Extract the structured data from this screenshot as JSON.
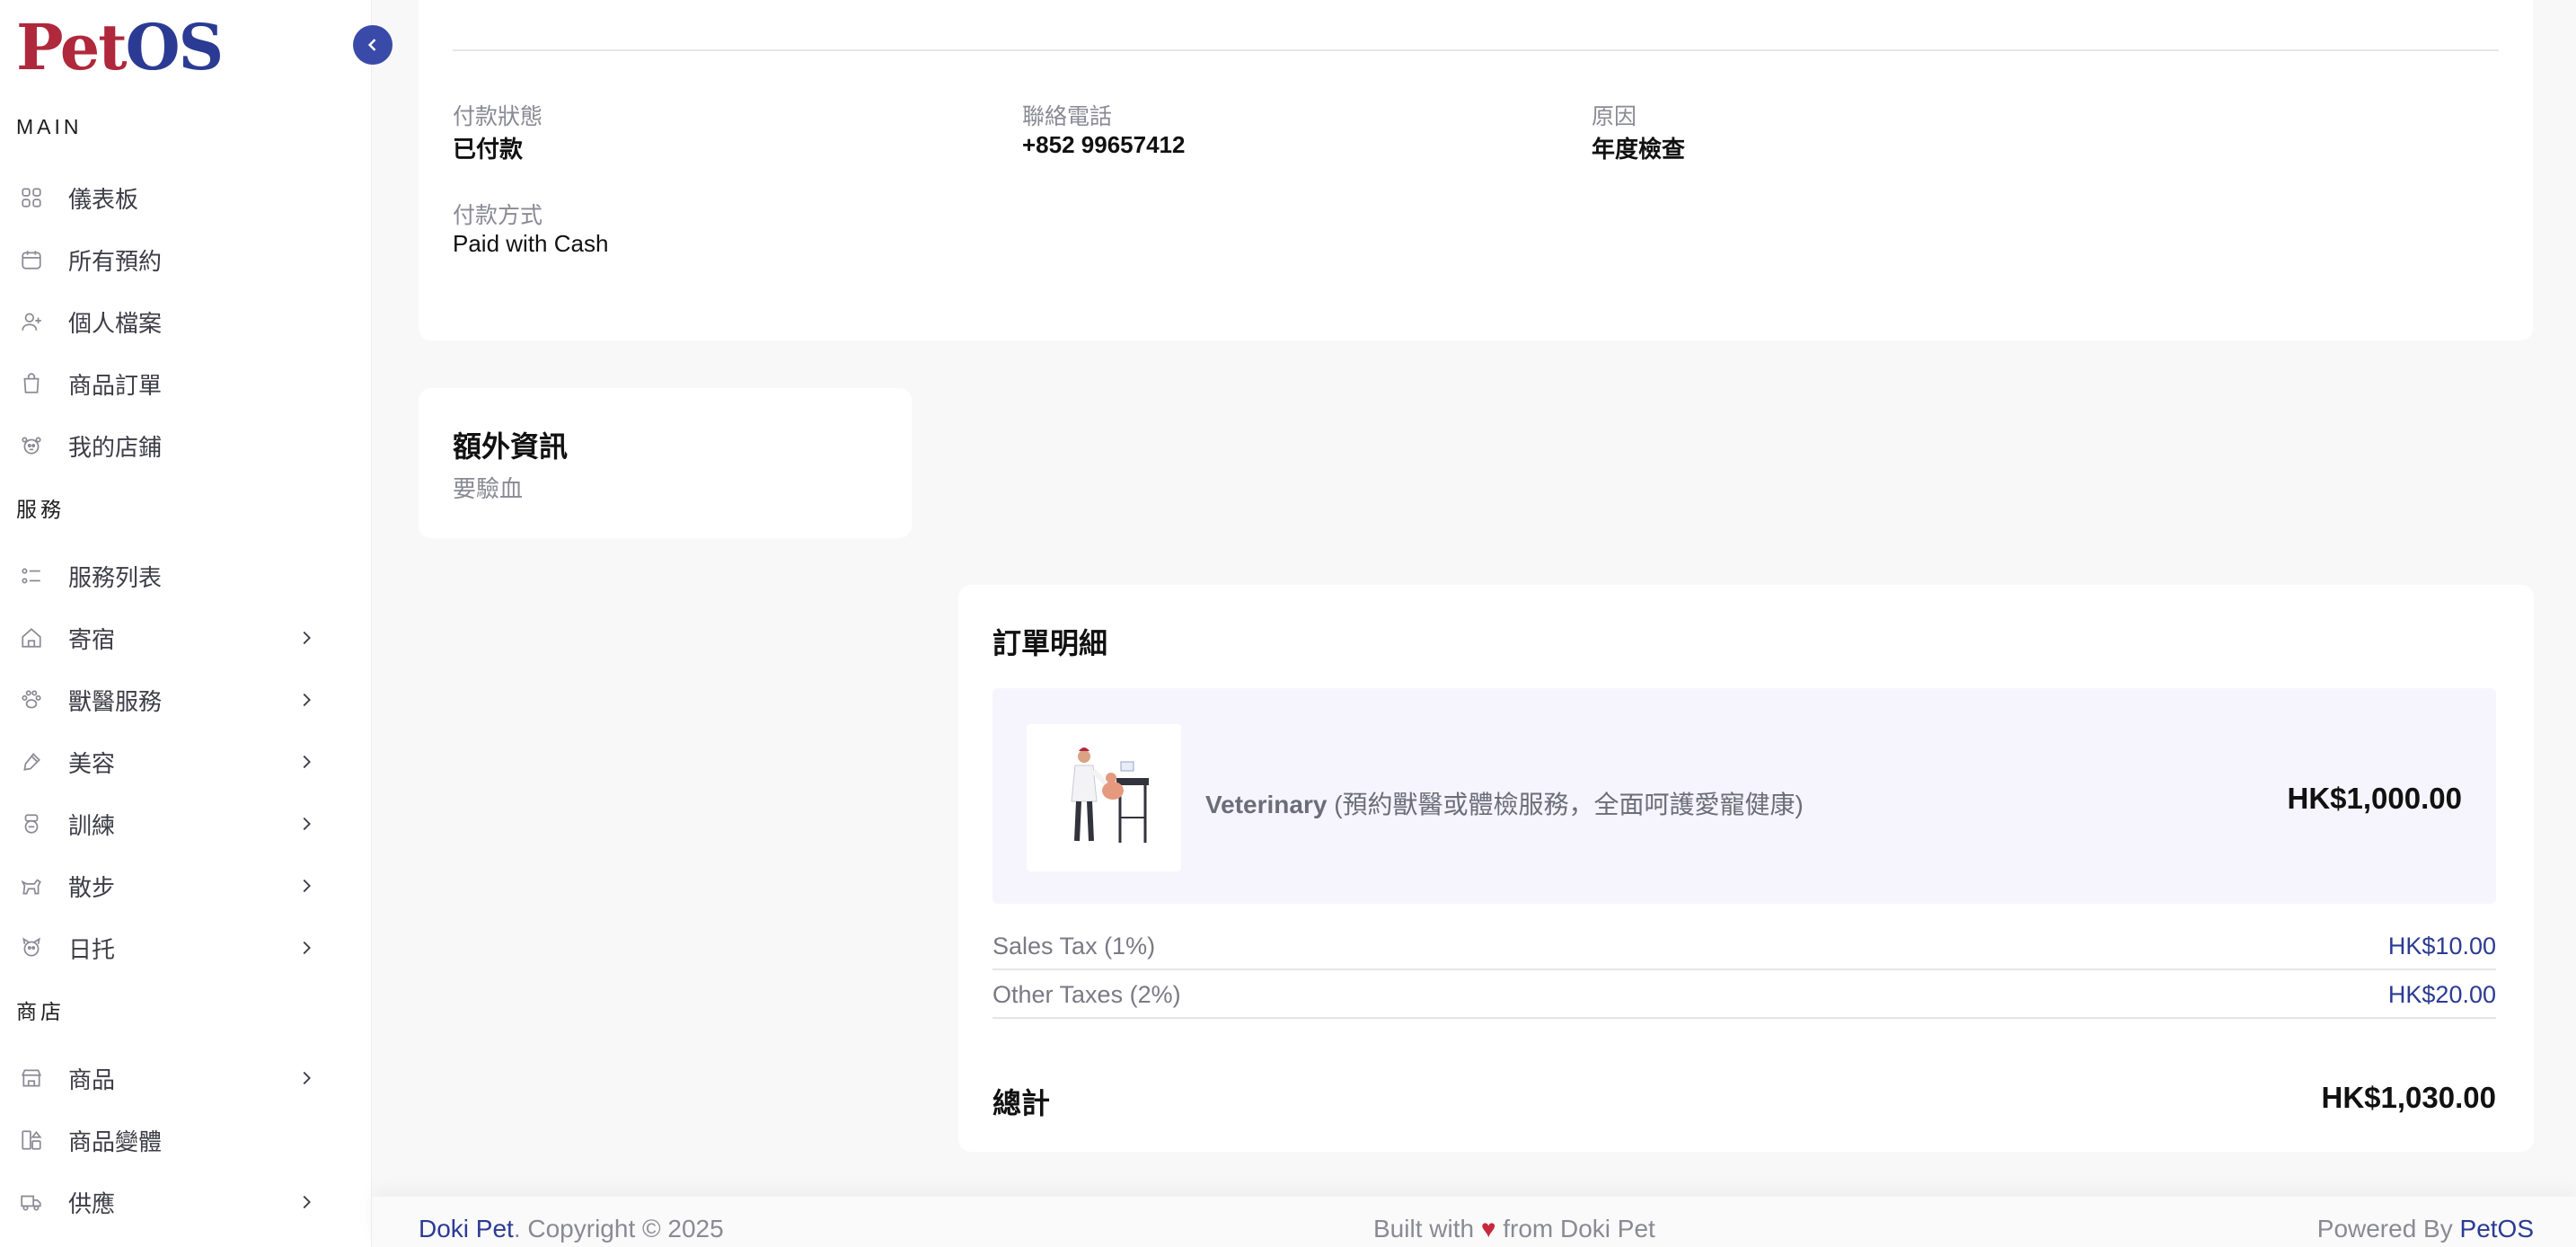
{
  "brand": {
    "logo_pet": "Pet",
    "logo_os": "OS"
  },
  "sidebar": {
    "sections": {
      "main": "MAIN",
      "services": "服務",
      "shop": "商店"
    },
    "items": [
      {
        "label": "儀表板",
        "icon": "grid-icon"
      },
      {
        "label": "所有預約",
        "icon": "calendar-icon"
      },
      {
        "label": "個人檔案",
        "icon": "user-add-icon"
      },
      {
        "label": "商品訂單",
        "icon": "shopping-bag-icon"
      },
      {
        "label": "我的店鋪",
        "icon": "store-icon"
      },
      {
        "label": "服務列表",
        "icon": "list-icon"
      },
      {
        "label": "寄宿",
        "icon": "house-icon"
      },
      {
        "label": "獸醫服務",
        "icon": "paw-icon"
      },
      {
        "label": "美容",
        "icon": "brush-icon"
      },
      {
        "label": "訓練",
        "icon": "medal-icon"
      },
      {
        "label": "散步",
        "icon": "dog-icon"
      },
      {
        "label": "日托",
        "icon": "pet-face-icon"
      },
      {
        "label": "商品",
        "icon": "storefront-icon"
      },
      {
        "label": "商品變體",
        "icon": "variants-icon"
      },
      {
        "label": "供應",
        "icon": "truck-icon"
      }
    ]
  },
  "booking": {
    "payment_status_label": "付款狀態",
    "payment_status": "已付款",
    "phone_label": "聯絡電話",
    "phone": "+852 99657412",
    "reason_label": "原因",
    "reason": "年度檢查",
    "payment_method_label": "付款方式",
    "payment_method": "Paid with Cash"
  },
  "extra": {
    "title": "額外資訊",
    "text": "要驗血"
  },
  "order": {
    "title": "訂單明細",
    "item_name": "Veterinary",
    "item_desc": " (預約獸醫或體檢服務，全面呵護愛寵健康)",
    "item_price": "HK$1,000.00",
    "sales_tax_label": "Sales Tax (1%)",
    "sales_tax": "HK$10.00",
    "other_tax_label": "Other Taxes (2%)",
    "other_tax": "HK$20.00",
    "total_label": "總計",
    "total": "HK$1,030.00"
  },
  "footer": {
    "company": "Doki Pet",
    "copyright": ". Copyright © 2025",
    "built_with": "Built with",
    "heart": "♥",
    "from": "from Doki Pet",
    "powered_by": "Powered By",
    "powered_brand": "PetOS"
  },
  "colors": {
    "accent": "#2b3b94",
    "brand_red": "#b0283b",
    "heart": "#c8283f"
  }
}
